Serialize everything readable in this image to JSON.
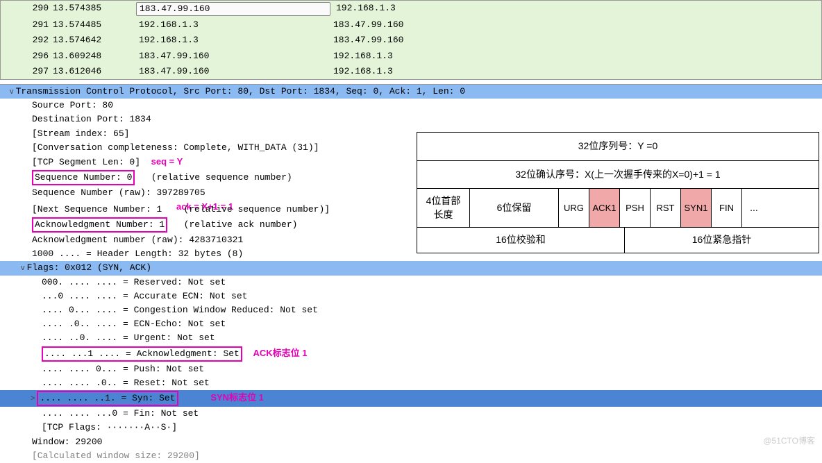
{
  "packets": [
    {
      "no": "290",
      "time": "13.574385",
      "src": "183.47.99.160",
      "dst": "192.168.1.3"
    },
    {
      "no": "291",
      "time": "13.574485",
      "src": "192.168.1.3",
      "dst": "183.47.99.160"
    },
    {
      "no": "292",
      "time": "13.574642",
      "src": "192.168.1.3",
      "dst": "183.47.99.160"
    },
    {
      "no": "296",
      "time": "13.609248",
      "src": "183.47.99.160",
      "dst": "192.168.1.3"
    },
    {
      "no": "297",
      "time": "13.612046",
      "src": "183.47.99.160",
      "dst": "192.168.1.3"
    }
  ],
  "details": {
    "tcp_header": "Transmission Control Protocol, Src Port: 80, Dst Port: 1834, Seq: 0, Ack: 1, Len: 0",
    "src_port": "Source Port: 80",
    "dst_port": "Destination Port: 1834",
    "stream_idx": "[Stream index: 65]",
    "conv": "[Conversation completeness: Complete, WITH_DATA (31)]",
    "seg_len": "[TCP Segment Len: 0]",
    "seq_label": "seq = Y",
    "seq_num": "Sequence Number: 0",
    "seq_rel": "   (relative sequence number)",
    "seq_raw": "Sequence Number (raw): 397289705",
    "ack_label": "ack = X+1 = 1",
    "next_seq": "[Next Sequence Number: 1    (relative sequence number)]",
    "ack_num": "Acknowledgment Number: 1",
    "ack_rel": "   (relative ack number)",
    "ack_raw": "Acknowledgment number (raw): 4283710321",
    "hdr_len": "1000 .... = Header Length: 32 bytes (8)",
    "flags_hdr": "Flags: 0x012 (SYN, ACK)",
    "f_reserved": "000. .... .... = Reserved: Not set",
    "f_ae": "...0 .... .... = Accurate ECN: Not set",
    "f_cwr": ".... 0... .... = Congestion Window Reduced: Not set",
    "f_ece": ".... .0.. .... = ECN-Echo: Not set",
    "f_urg": ".... ..0. .... = Urgent: Not set",
    "f_ack": ".... ...1 .... = Acknowledgment: Set",
    "ack_flag_label": "ACK标志位 1",
    "f_psh": ".... .... 0... = Push: Not set",
    "f_rst": ".... .... .0.. = Reset: Not set",
    "f_syn": ".... .... ..1. = Syn: Set",
    "syn_flag_label": "SYN标志位 1",
    "f_fin": ".... .... ...0 = Fin: Not set",
    "tcp_flags": "[TCP Flags: ·······A··S·]",
    "window": "Window: 29200",
    "calc_win": "[Calculated window size: 29200]"
  },
  "diagram": {
    "row1": "32位序列号：Y =0",
    "row2": "32位确认序号：X(上一次握手传来的X=0)+1 = 1",
    "header_len": "4位首部\n长度",
    "reserved": "6位保留",
    "urg_label": "URG",
    "ack_label": "ACK",
    "ack_val": "1",
    "psh_label": "PSH",
    "rst_label": "RST",
    "syn_label": "SYN",
    "syn_val": "1",
    "fin_label": "FIN",
    "dots": "...",
    "checksum": "16位校验和",
    "urgent_ptr": "16位紧急指针"
  },
  "watermark": "@51CTO博客"
}
